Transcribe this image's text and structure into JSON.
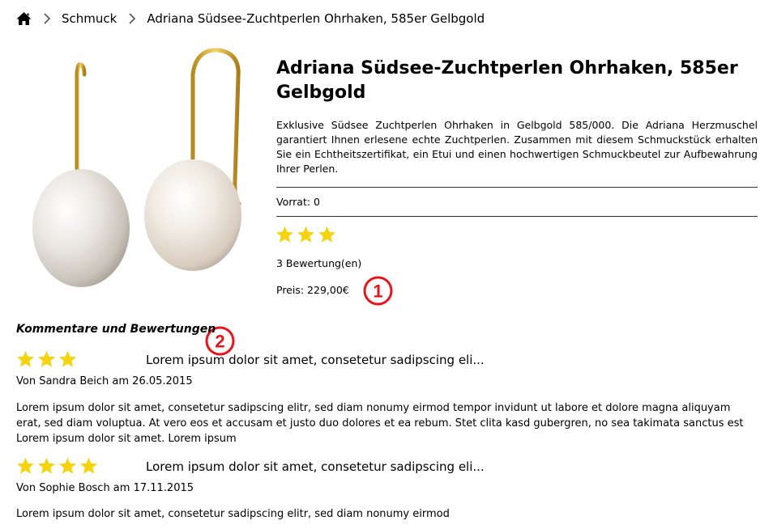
{
  "breadcrumb": {
    "home_icon": "home-icon",
    "items": [
      "Schmuck",
      "Adriana Südsee-Zuchtperlen Ohrhaken, 585er Gelbgold"
    ]
  },
  "product": {
    "image_alt": "Pearl earrings image",
    "title": "Adriana Südsee-Zuchtperlen Ohrhaken, 585er Gelbgold",
    "description": "Exklusive Südsee Zuchtperlen Ohrhaken in Gelbgold 585/000. Die Adriana Herzmuschel garantiert Ihnen erlesene echte Zuchtperlen. Zusammen mit diesem Schmuckstück erhalten Sie ein Echtheitszertifikat, ein Etui und einen hochwertigen Schmuckbeutel zur Aufbewahrung Ihrer Perlen.",
    "stock": "Vorrat: 0",
    "rating_stars": 3,
    "rating_count": "3 Bewertung(en)",
    "price": "Preis: 229,00€"
  },
  "markers": [
    "1",
    "2"
  ],
  "reviews": {
    "heading": "Kommentare und Bewertungen",
    "items": [
      {
        "stars": 3,
        "title": "Lorem ipsum dolor sit amet, consetetur sadipscing eli...",
        "meta": "Von Sandra Beich am 26.05.2015",
        "body": "Lorem ipsum dolor sit amet, consetetur sadipscing elitr, sed diam nonumy eirmod tempor invidunt ut labore et dolore magna aliquyam erat, sed diam voluptua. At vero eos et accusam et justo duo dolores et ea rebum. Stet clita kasd gubergren, no sea takimata sanctus est Lorem ipsum dolor sit amet. Lorem ipsum"
      },
      {
        "stars": 4,
        "title": "Lorem ipsum dolor sit amet, consetetur sadipscing eli...",
        "meta": "Von Sophie Bosch am 17.11.2015",
        "body": "Lorem ipsum dolor sit amet, consetetur sadipscing elitr, sed diam nonumy eirmod"
      }
    ]
  },
  "colors": {
    "star": "#f5d40f",
    "marker": "#e8141b",
    "gold": "#d4a62a"
  }
}
